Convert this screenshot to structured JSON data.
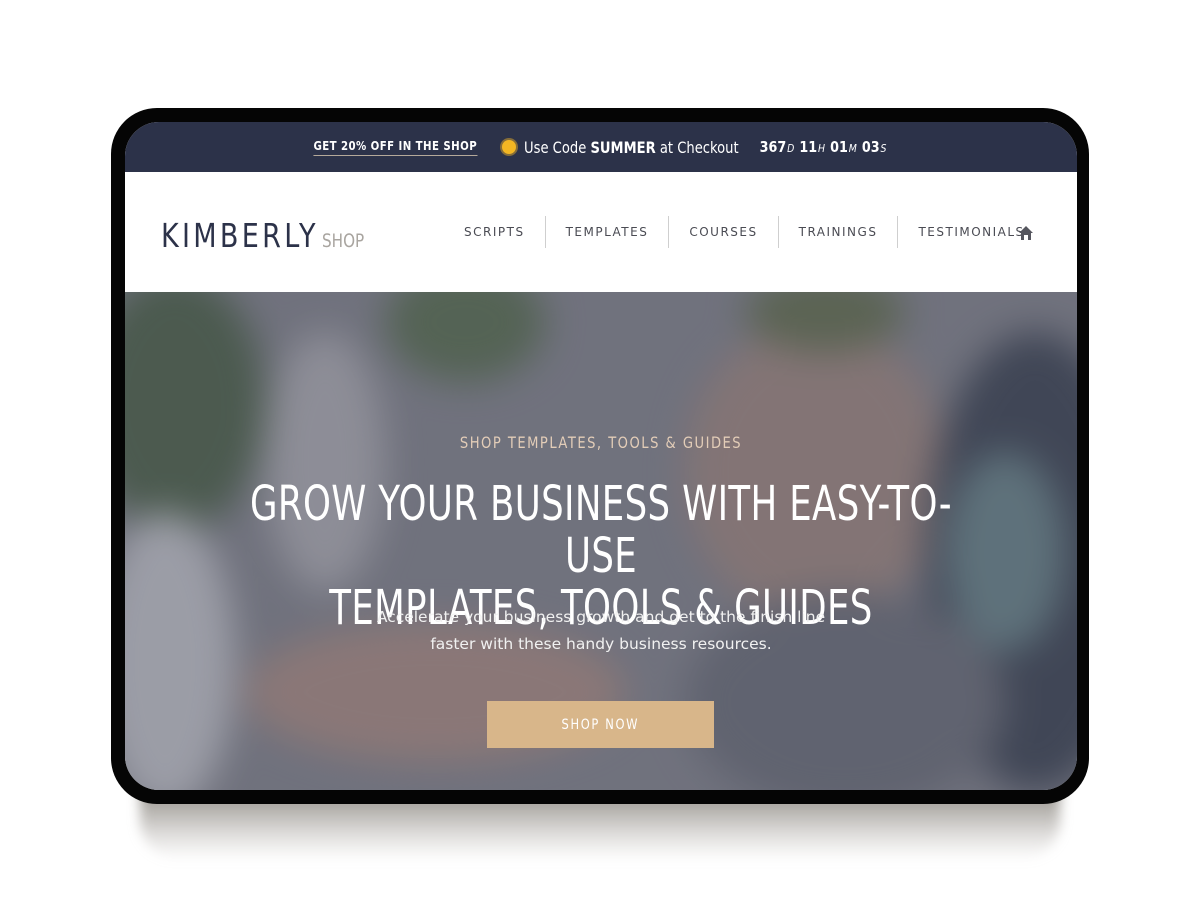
{
  "promo_bar": {
    "link_label": "GET 20% OFF IN THE SHOP",
    "code_prefix": "Use Code ",
    "code": "SUMMER",
    "code_suffix": " at Checkout",
    "icon": "sun-icon",
    "countdown": {
      "days": "367",
      "days_unit": "D",
      "hours": "11",
      "hours_unit": "H",
      "minutes": "01",
      "minutes_unit": "M",
      "seconds": "03",
      "seconds_unit": "S"
    }
  },
  "header": {
    "logo_main": "KIMBERLY",
    "logo_sub": "SHOP",
    "nav": [
      {
        "label": "SCRIPTS"
      },
      {
        "label": "TEMPLATES"
      },
      {
        "label": "COURSES"
      },
      {
        "label": "TRAININGS"
      },
      {
        "label": "TESTIMONIALS"
      }
    ],
    "home_icon": "home-icon"
  },
  "hero": {
    "eyebrow": "SHOP TEMPLATES, TOOLS & GUIDES",
    "headline_line1": "GROW YOUR BUSINESS WITH EASY-TO-USE",
    "headline_line2": "TEMPLATES, TOOLS & GUIDES",
    "subtext_line1": "Accelerate your business growth and get to the finish line",
    "subtext_line2": "faster with these handy business resources.",
    "cta_label": "SHOP NOW"
  },
  "colors": {
    "promo_bg": "#2c3249",
    "brand_navy": "#2c3249",
    "cta_tan": "#d8b68a",
    "eyebrow_tan": "#e3cdb8",
    "logo_sub_gray": "#a9a5a0"
  }
}
